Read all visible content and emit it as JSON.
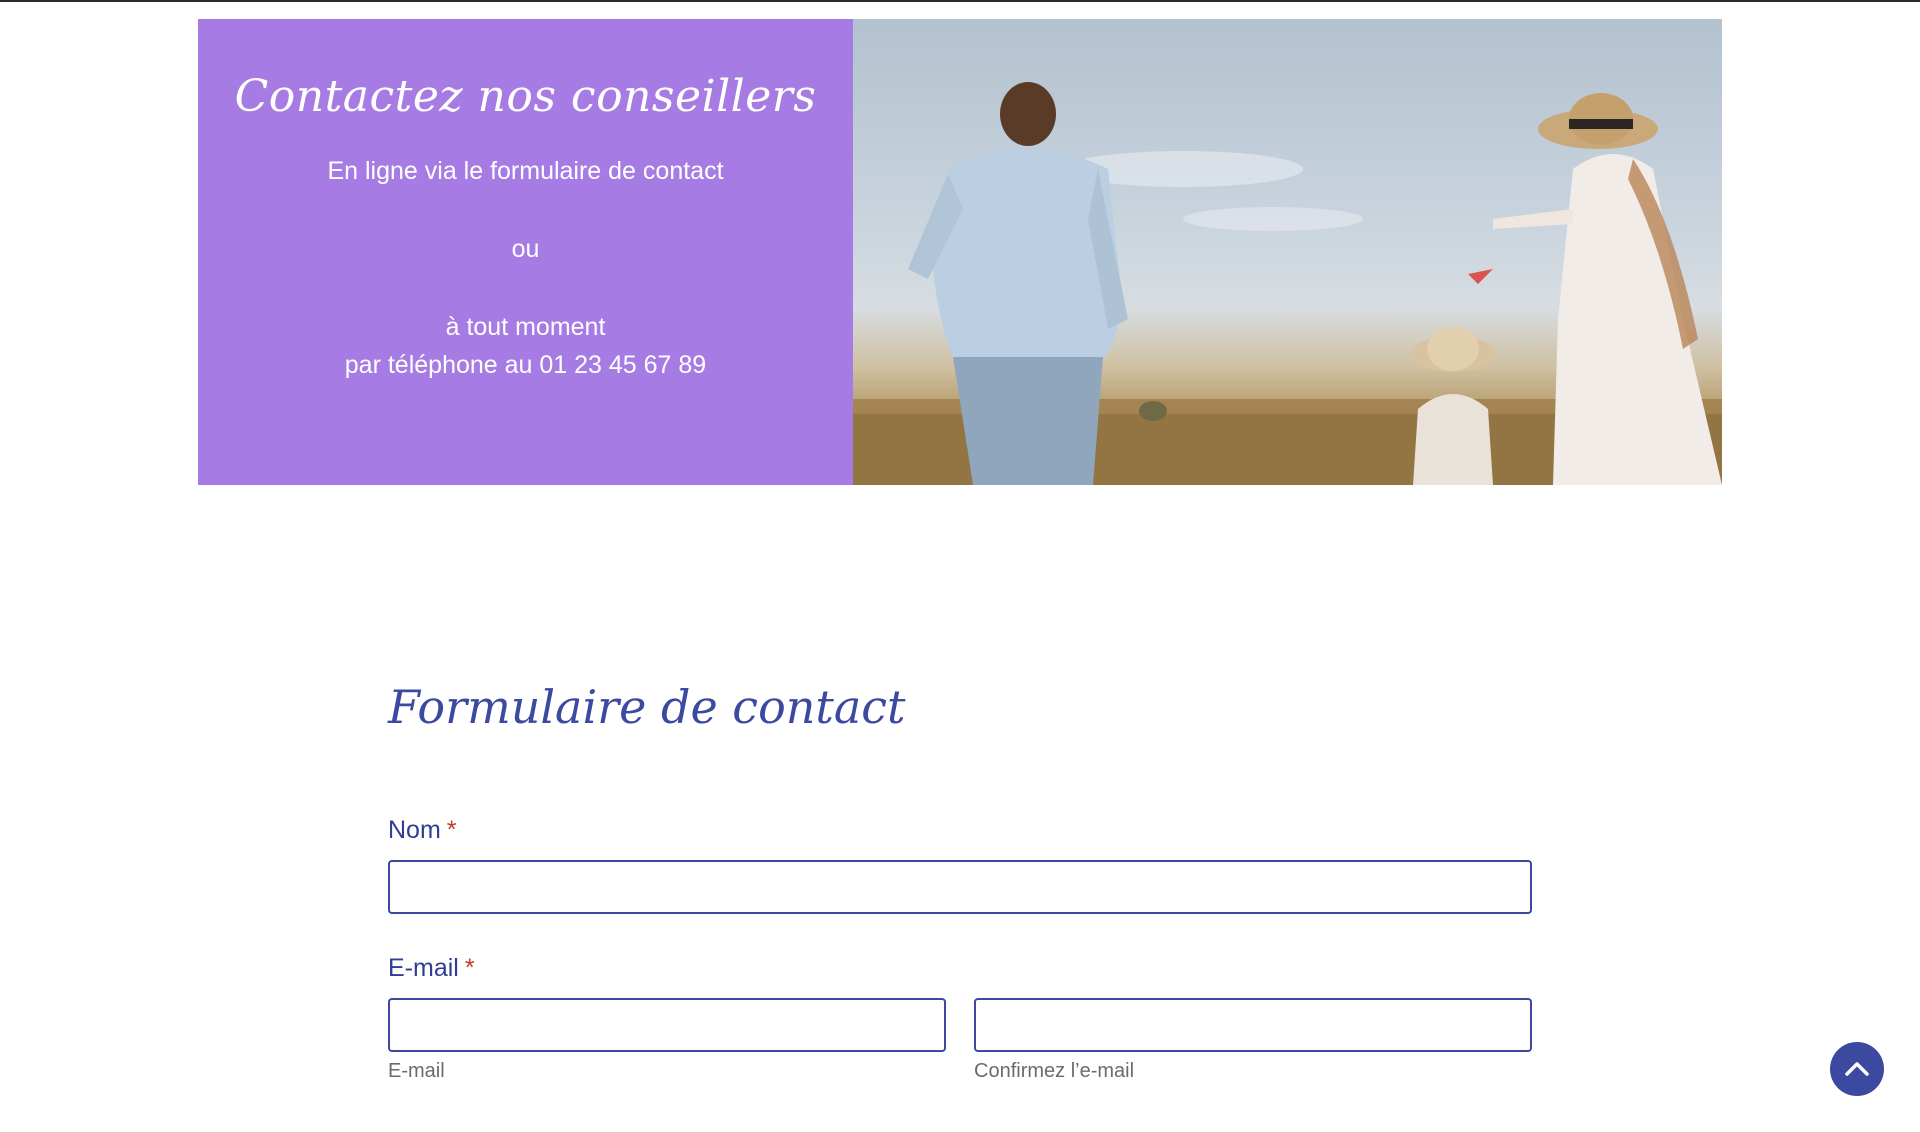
{
  "hero": {
    "title": "Contactez nos conseillers",
    "line1": "En ligne via le formulaire de contact",
    "line2": "ou",
    "line3": "à tout moment",
    "line4": "par téléphone au 01 23 45 67 89",
    "panel_color": "#a67ce4"
  },
  "form": {
    "title": "Formulaire de contact",
    "name_label": "Nom",
    "email_label": "E-mail",
    "required_mark": "*",
    "email_sublabel": "E-mail",
    "email_confirm_sublabel": "Confirmez l’e-mail",
    "name_value": "",
    "email_value": "",
    "email_confirm_value": "",
    "accent_color": "#3b4aa0"
  },
  "scroll_top": {
    "icon": "chevron-up-icon"
  }
}
